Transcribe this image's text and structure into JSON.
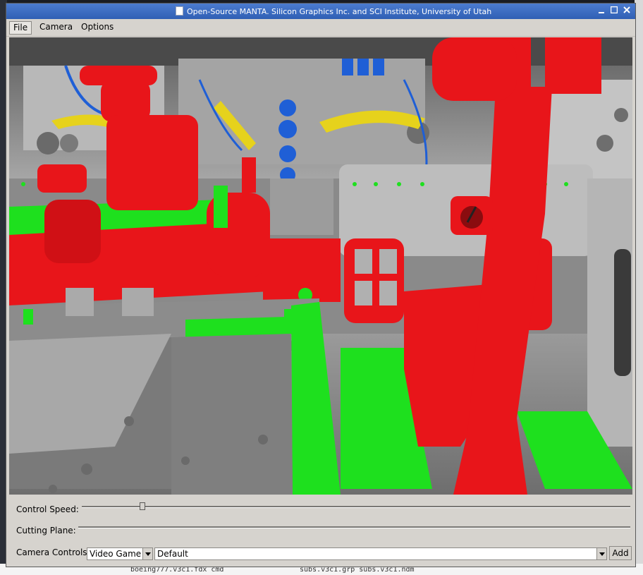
{
  "window": {
    "title": "Open-Source MANTA. Silicon Graphics Inc. and SCI Institute, University of Utah"
  },
  "menubar": {
    "items": [
      {
        "label": "File"
      },
      {
        "label": "Camera"
      },
      {
        "label": "Options"
      }
    ]
  },
  "controls": {
    "control_speed": {
      "label": "Control Speed:",
      "value_fraction": 0.11
    },
    "cutting_plane": {
      "label": "Cutting Plane:"
    },
    "camera_controls": {
      "label": "Camera Controls:",
      "mode_value": "Video Game",
      "preset_value": "Default",
      "add_label": "Add"
    }
  },
  "desktop": {
    "bottom_text_1": "boeing777.v3c1.fdx  cmd",
    "bottom_text_2": "subs.v3c1.grp  subs.v3c1.ndm"
  },
  "colors": {
    "titlebar": "#3a6cc4",
    "highlight_red": "#e8151a",
    "highlight_green": "#1ee01e",
    "highlight_blue": "#1f5fd6",
    "highlight_yellow": "#e6d21c"
  }
}
